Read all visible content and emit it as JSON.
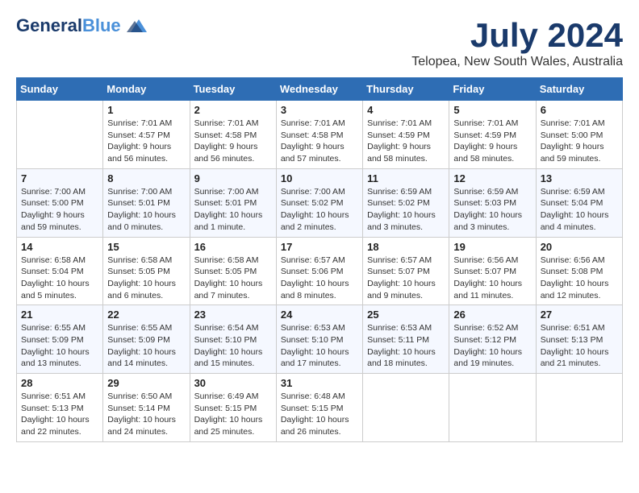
{
  "header": {
    "logo_line1": "General",
    "logo_line2": "Blue",
    "month": "July 2024",
    "location": "Telopea, New South Wales, Australia"
  },
  "weekdays": [
    "Sunday",
    "Monday",
    "Tuesday",
    "Wednesday",
    "Thursday",
    "Friday",
    "Saturday"
  ],
  "weeks": [
    [
      {
        "day": "",
        "sunrise": "",
        "sunset": "",
        "daylight": ""
      },
      {
        "day": "1",
        "sunrise": "Sunrise: 7:01 AM",
        "sunset": "Sunset: 4:57 PM",
        "daylight": "Daylight: 9 hours and 56 minutes."
      },
      {
        "day": "2",
        "sunrise": "Sunrise: 7:01 AM",
        "sunset": "Sunset: 4:58 PM",
        "daylight": "Daylight: 9 hours and 56 minutes."
      },
      {
        "day": "3",
        "sunrise": "Sunrise: 7:01 AM",
        "sunset": "Sunset: 4:58 PM",
        "daylight": "Daylight: 9 hours and 57 minutes."
      },
      {
        "day": "4",
        "sunrise": "Sunrise: 7:01 AM",
        "sunset": "Sunset: 4:59 PM",
        "daylight": "Daylight: 9 hours and 58 minutes."
      },
      {
        "day": "5",
        "sunrise": "Sunrise: 7:01 AM",
        "sunset": "Sunset: 4:59 PM",
        "daylight": "Daylight: 9 hours and 58 minutes."
      },
      {
        "day": "6",
        "sunrise": "Sunrise: 7:01 AM",
        "sunset": "Sunset: 5:00 PM",
        "daylight": "Daylight: 9 hours and 59 minutes."
      }
    ],
    [
      {
        "day": "7",
        "sunrise": "Sunrise: 7:00 AM",
        "sunset": "Sunset: 5:00 PM",
        "daylight": "Daylight: 9 hours and 59 minutes."
      },
      {
        "day": "8",
        "sunrise": "Sunrise: 7:00 AM",
        "sunset": "Sunset: 5:01 PM",
        "daylight": "Daylight: 10 hours and 0 minutes."
      },
      {
        "day": "9",
        "sunrise": "Sunrise: 7:00 AM",
        "sunset": "Sunset: 5:01 PM",
        "daylight": "Daylight: 10 hours and 1 minute."
      },
      {
        "day": "10",
        "sunrise": "Sunrise: 7:00 AM",
        "sunset": "Sunset: 5:02 PM",
        "daylight": "Daylight: 10 hours and 2 minutes."
      },
      {
        "day": "11",
        "sunrise": "Sunrise: 6:59 AM",
        "sunset": "Sunset: 5:02 PM",
        "daylight": "Daylight: 10 hours and 3 minutes."
      },
      {
        "day": "12",
        "sunrise": "Sunrise: 6:59 AM",
        "sunset": "Sunset: 5:03 PM",
        "daylight": "Daylight: 10 hours and 3 minutes."
      },
      {
        "day": "13",
        "sunrise": "Sunrise: 6:59 AM",
        "sunset": "Sunset: 5:04 PM",
        "daylight": "Daylight: 10 hours and 4 minutes."
      }
    ],
    [
      {
        "day": "14",
        "sunrise": "Sunrise: 6:58 AM",
        "sunset": "Sunset: 5:04 PM",
        "daylight": "Daylight: 10 hours and 5 minutes."
      },
      {
        "day": "15",
        "sunrise": "Sunrise: 6:58 AM",
        "sunset": "Sunset: 5:05 PM",
        "daylight": "Daylight: 10 hours and 6 minutes."
      },
      {
        "day": "16",
        "sunrise": "Sunrise: 6:58 AM",
        "sunset": "Sunset: 5:05 PM",
        "daylight": "Daylight: 10 hours and 7 minutes."
      },
      {
        "day": "17",
        "sunrise": "Sunrise: 6:57 AM",
        "sunset": "Sunset: 5:06 PM",
        "daylight": "Daylight: 10 hours and 8 minutes."
      },
      {
        "day": "18",
        "sunrise": "Sunrise: 6:57 AM",
        "sunset": "Sunset: 5:07 PM",
        "daylight": "Daylight: 10 hours and 9 minutes."
      },
      {
        "day": "19",
        "sunrise": "Sunrise: 6:56 AM",
        "sunset": "Sunset: 5:07 PM",
        "daylight": "Daylight: 10 hours and 11 minutes."
      },
      {
        "day": "20",
        "sunrise": "Sunrise: 6:56 AM",
        "sunset": "Sunset: 5:08 PM",
        "daylight": "Daylight: 10 hours and 12 minutes."
      }
    ],
    [
      {
        "day": "21",
        "sunrise": "Sunrise: 6:55 AM",
        "sunset": "Sunset: 5:09 PM",
        "daylight": "Daylight: 10 hours and 13 minutes."
      },
      {
        "day": "22",
        "sunrise": "Sunrise: 6:55 AM",
        "sunset": "Sunset: 5:09 PM",
        "daylight": "Daylight: 10 hours and 14 minutes."
      },
      {
        "day": "23",
        "sunrise": "Sunrise: 6:54 AM",
        "sunset": "Sunset: 5:10 PM",
        "daylight": "Daylight: 10 hours and 15 minutes."
      },
      {
        "day": "24",
        "sunrise": "Sunrise: 6:53 AM",
        "sunset": "Sunset: 5:10 PM",
        "daylight": "Daylight: 10 hours and 17 minutes."
      },
      {
        "day": "25",
        "sunrise": "Sunrise: 6:53 AM",
        "sunset": "Sunset: 5:11 PM",
        "daylight": "Daylight: 10 hours and 18 minutes."
      },
      {
        "day": "26",
        "sunrise": "Sunrise: 6:52 AM",
        "sunset": "Sunset: 5:12 PM",
        "daylight": "Daylight: 10 hours and 19 minutes."
      },
      {
        "day": "27",
        "sunrise": "Sunrise: 6:51 AM",
        "sunset": "Sunset: 5:13 PM",
        "daylight": "Daylight: 10 hours and 21 minutes."
      }
    ],
    [
      {
        "day": "28",
        "sunrise": "Sunrise: 6:51 AM",
        "sunset": "Sunset: 5:13 PM",
        "daylight": "Daylight: 10 hours and 22 minutes."
      },
      {
        "day": "29",
        "sunrise": "Sunrise: 6:50 AM",
        "sunset": "Sunset: 5:14 PM",
        "daylight": "Daylight: 10 hours and 24 minutes."
      },
      {
        "day": "30",
        "sunrise": "Sunrise: 6:49 AM",
        "sunset": "Sunset: 5:15 PM",
        "daylight": "Daylight: 10 hours and 25 minutes."
      },
      {
        "day": "31",
        "sunrise": "Sunrise: 6:48 AM",
        "sunset": "Sunset: 5:15 PM",
        "daylight": "Daylight: 10 hours and 26 minutes."
      },
      {
        "day": "",
        "sunrise": "",
        "sunset": "",
        "daylight": ""
      },
      {
        "day": "",
        "sunrise": "",
        "sunset": "",
        "daylight": ""
      },
      {
        "day": "",
        "sunrise": "",
        "sunset": "",
        "daylight": ""
      }
    ]
  ]
}
